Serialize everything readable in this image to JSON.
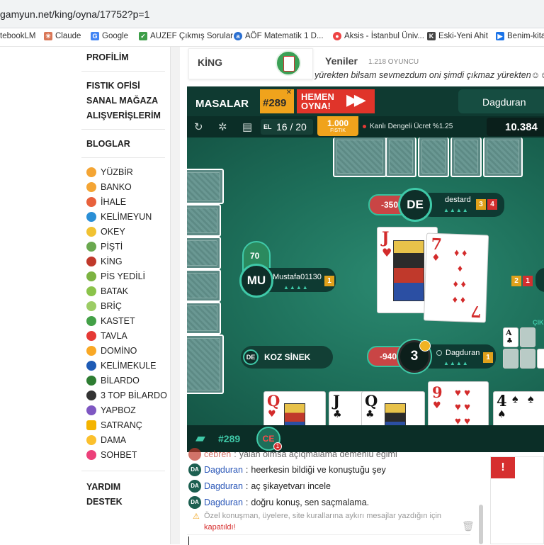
{
  "browser": {
    "url": "gamyun.net/king/oyna/17752?p=1",
    "bookmarks": [
      {
        "label": "tebookLM",
        "icon": "notebook-icon"
      },
      {
        "label": "Claude",
        "icon": "claude-icon"
      },
      {
        "label": "Google",
        "icon": "google-icon"
      },
      {
        "label": "AUZEF Çıkmış Sorular",
        "icon": "auzef-icon"
      },
      {
        "label": "AÖF Matematik 1 D...",
        "icon": "aof-icon"
      },
      {
        "label": "Aksis - İstanbul Üniv...",
        "icon": "aksis-icon"
      },
      {
        "label": "Eski-Yeni Ahit",
        "icon": "kk-icon"
      },
      {
        "label": "Benim-kita",
        "icon": "play-icon"
      }
    ]
  },
  "nav": {
    "profile": "PROFİLİM",
    "fistik": "FISTIK OFİSİ",
    "store": "SANAL MAĞAZA",
    "shopping": "ALIŞVERİŞLERİM",
    "blogs": "BLOGLAR",
    "games": [
      "YÜZBİR",
      "BANKO",
      "İHALE",
      "KELİMEYUN",
      "OKEY",
      "PİŞTİ",
      "KİNG",
      "PİS YEDİLİ",
      "BATAK",
      "BRİÇ",
      "KASTET",
      "TAVLA",
      "DOMİNO",
      "KELİMEKULE",
      "BİLARDO",
      "3 TOP BİLARDO",
      "YAPBOZ",
      "SATRANÇ",
      "DAMA",
      "SOHBET"
    ],
    "help": "YARDIM",
    "support": "DESTEK"
  },
  "colors": {
    "accent": "#3fc9a8",
    "felt": "#1d6e59",
    "header": "#0f3a31",
    "orange": "#f0a31c",
    "red": "#d62f2f"
  },
  "top": {
    "king_label": "KİNG",
    "news_title": "Yeniler",
    "players_online": "1.218 OYUNCU",
    "marquee": "yürekten bilsam sevmezdum oni şimdi çıkmaz yürekten☺☺ İns"
  },
  "game": {
    "tables_label": "MASALAR",
    "table_number": "#289",
    "play_now": "HEMEN OYNA!",
    "user": "Dagduran",
    "el_label": "EL",
    "hand_progress": "16 / 20",
    "fistik_amount": "1.000",
    "fistik_label": "FISTIK",
    "fee_text": "Kanlı Dengeli Ücret %1.25",
    "balance": "10.384",
    "trump_label": "KOZ SİNEK",
    "trump_badge": "DE",
    "ciki_label": "ÇIK",
    "players": {
      "top": {
        "initials": "DE",
        "name": "destard",
        "score": "-350",
        "badge_a": "3",
        "badge_b": "4"
      },
      "left": {
        "initials": "MU",
        "name": "Mustafa01130",
        "score": "70",
        "badge_a": "1"
      },
      "right": {
        "badge_a": "2",
        "badge_b": "1"
      },
      "me": {
        "initials": "3",
        "name": "Dagduran",
        "score": "-940",
        "badge_a": "1"
      }
    },
    "center_cards": [
      {
        "rank": "J",
        "suit": "♥"
      },
      {
        "rank": "7",
        "suit": "♦"
      }
    ],
    "hand": [
      {
        "rank": "Q",
        "suit": "♥"
      },
      {
        "rank": "J",
        "suit": "♣"
      },
      {
        "rank": "Q",
        "suit": "♣"
      },
      {
        "rank": "9",
        "suit": "♥"
      },
      {
        "rank": "4",
        "suit": "♠"
      }
    ],
    "side_cards": [
      {
        "rank": "A",
        "suit": "♣"
      }
    ],
    "chat_table_number": "#289",
    "chat_avatar": "CE",
    "chat_notify": "1"
  },
  "chat": {
    "messages": [
      {
        "avatar": "",
        "name": "cebren",
        "text": "yalan olmsa açıqmalama demeniu egimi"
      },
      {
        "avatar": "DA",
        "name": "Dagduran",
        "text": "heerkesin bildiği ve konuştuğu şey"
      },
      {
        "avatar": "DA",
        "name": "Dagduran",
        "text": "aç şikayetvarı incele"
      },
      {
        "avatar": "DA",
        "name": "Dagduran",
        "text": "doğru konuş, sen saçmalama."
      }
    ],
    "warning": "Özel konuşman, üyelere, site kurallarına aykırı mesajlar yazdığın için",
    "warning_end": "kapatıldı!"
  }
}
